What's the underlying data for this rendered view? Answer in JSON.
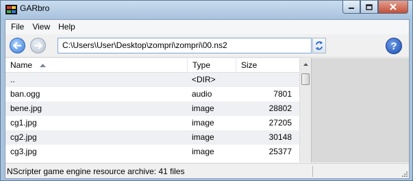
{
  "window": {
    "title": "GARbro"
  },
  "menu": {
    "items": [
      "File",
      "View",
      "Help"
    ]
  },
  "toolbar": {
    "path": "C:\\Users\\User\\Desktop\\zompri\\zompri\\00.ns2",
    "help_label": "?"
  },
  "list": {
    "columns": [
      "Name",
      "Type",
      "Size"
    ],
    "rows": [
      {
        "name": "..",
        "type": "<DIR>",
        "size": ""
      },
      {
        "name": "ban.ogg",
        "type": "audio",
        "size": "7801"
      },
      {
        "name": "bene.jpg",
        "type": "image",
        "size": "28802"
      },
      {
        "name": "cg1.jpg",
        "type": "image",
        "size": "27205"
      },
      {
        "name": "cg2.jpg",
        "type": "image",
        "size": "30148"
      },
      {
        "name": "cg3.jpg",
        "type": "image",
        "size": "25377"
      }
    ]
  },
  "status": {
    "text": "NScripter game engine resource archive: 41 files"
  },
  "colors": {
    "title_bar": "#a9c3de",
    "alt_row": "#eef0f3",
    "help_blue": "#1b4fb3"
  }
}
